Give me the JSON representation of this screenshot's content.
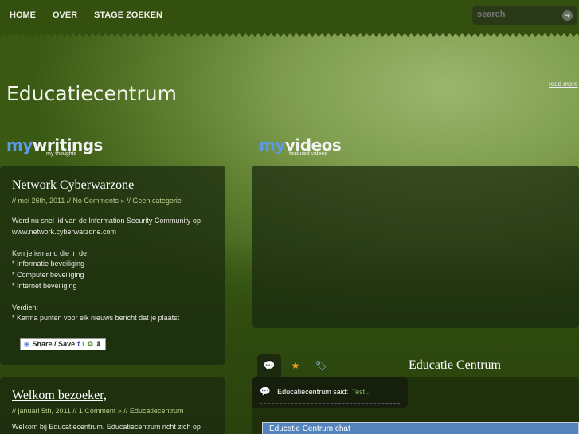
{
  "nav": {
    "items": [
      "HOME",
      "OVER",
      "STAGE ZOEKEN"
    ],
    "search_placeholder": "search"
  },
  "header": {
    "title": "Educatiecentrum",
    "read_more": "read more"
  },
  "writings": {
    "heading_my": "my",
    "heading_rest": "writings",
    "sub": "my thoughts"
  },
  "videos": {
    "heading_my": "my",
    "heading_rest": "videos",
    "sub": "featured videos"
  },
  "posts": [
    {
      "title": "Network Cyberwarzone",
      "meta": "// mei 26th, 2011 // No Comments » // Geen categorie",
      "body": [
        "Word nu snel lid van de Information Security Community op",
        "www.network.cyberwarzone.com",
        "",
        "Ken je iemand die in de:",
        "* Informatie beveiliging",
        "* Computer beveiliging",
        "* Internet beveiliging",
        "",
        "Verdien:",
        "* Karma punten voor elk nieuws bericht dat je plaatst"
      ],
      "share": "Share / Save"
    },
    {
      "title": "Welkom bezoeker,",
      "meta": "// januari 5th, 2011 // 1 Comment » // Educatiecentrum",
      "body": [
        "Welkom bij Educatiecentrum. Educatiecentrum richt zich op"
      ]
    }
  ],
  "sidebar": {
    "title": "Educatie Centrum",
    "comment_author": "Educatiecentrum said:",
    "comment_text": "Test...",
    "chat_title": "Educatie Centrum chat"
  },
  "colors": {
    "accent_blue": "#5a9ae8",
    "nav_bg": "#34500f",
    "chat_bar": "#5584bd"
  }
}
